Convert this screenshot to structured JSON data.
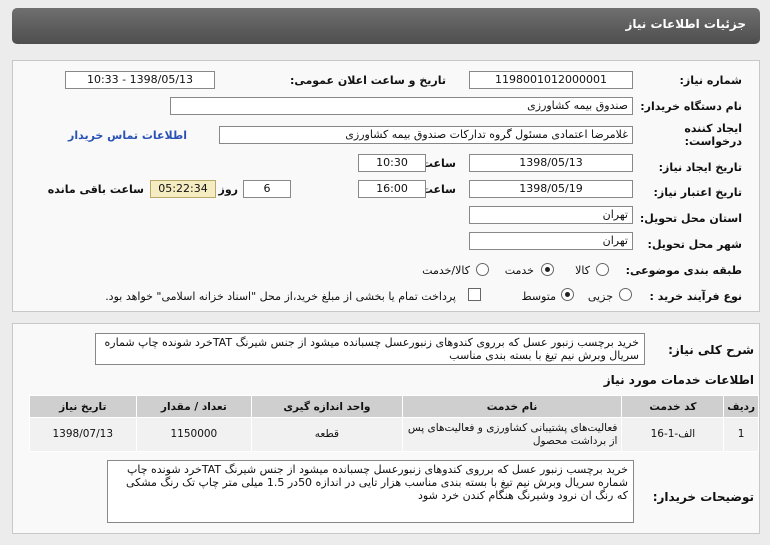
{
  "header": {
    "title": "جزئیات اطلاعات نیاز"
  },
  "form": {
    "need_number_label": "شماره نیاز:",
    "need_number": "1198001012000001",
    "announce_label": "تاریخ و ساعت اعلان عمومی:",
    "announce_value": "1398/05/13 - 10:33",
    "buyer_org_label": "نام دستگاه خریدار:",
    "buyer_org": "صندوق بیمه  کشاورزی",
    "requester_label_1": "ایجاد کننده",
    "requester_label_2": "درخواست:",
    "requester": "غلامرضا اعتمادی مسئول گروه تدارکات صندوق بیمه  کشاورزی",
    "contact_link": "اطلاعات تماس خریدار",
    "created_date_label": "تاریخ ایجاد نیاز:",
    "created_date": "1398/05/13",
    "time_label": "ساعت",
    "created_time": "10:30",
    "validity_label": "تاریخ اعتبار نیاز:",
    "validity_date": "1398/05/19",
    "validity_time": "16:00",
    "days": "6",
    "days_label": "روز و",
    "remaining": "05:22:34",
    "remaining_label": "ساعت باقی مانده",
    "province_label": "استان محل تحویل:",
    "province": "تهران",
    "city_label": "شهر محل تحویل:",
    "city": "تهران",
    "category_label": "طبقه بندی موضوعی:",
    "category_options": [
      "کالا",
      "خدمت",
      "کالا/خدمت"
    ],
    "category_selected": "خدمت",
    "process_label": "نوع فرآیند خرید :",
    "process_options": [
      "جزیی",
      "متوسط"
    ],
    "process_selected": "متوسط",
    "payment_note": "پرداخت تمام یا بخشی از مبلغ خرید،از محل \"اسناد خزانه اسلامی\" خواهد بود."
  },
  "summary": {
    "label": "شرح کلی نیاز:",
    "text": "خرید برچسب زنبور عسل که برروی کندوهای زنبورعسل چسبانده میشود از جنس شیرنگ TATخرد شونده چاپ شماره سریال وبرش نیم تیغ با بسته بندی مناسب"
  },
  "services": {
    "title": "اطلاعات خدمات مورد نیاز",
    "columns": [
      "ردیف",
      "کد خدمت",
      "نام خدمت",
      "واحد اندازه گیری",
      "تعداد / مقدار",
      "تاریخ نیاز"
    ],
    "rows": [
      [
        "1",
        "الف-1-16",
        "فعالیت‌های پشتیبانی کشاورزی و فعالیت‌های پس از برداشت محصول",
        "قطعه",
        "1150000",
        "1398/07/13"
      ]
    ]
  },
  "buyer_notes": {
    "label": "توضیحات خریدار:",
    "text": "خرید برچسب زنبور عسل که برروی کندوهای زنبورعسل چسبانده میشود از جنس شیرنگ TATخرد شونده چاپ شماره سریال وبرش نیم تیغ با بسته بندی مناسب هزار تایی در اندازه 50در 1.5 میلی متر چاپ تک رنگ مشکی که رنگ ان نرود وشیرنگ هنگام کندن خرد شود"
  }
}
